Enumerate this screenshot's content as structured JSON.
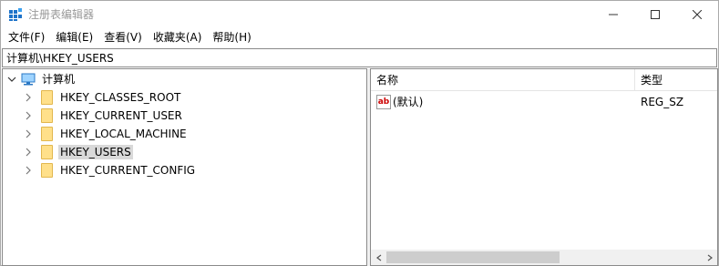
{
  "window": {
    "title": "注册表编辑器",
    "icon": "regedit-icon"
  },
  "menu": {
    "items": [
      "文件(F)",
      "编辑(E)",
      "查看(V)",
      "收藏夹(A)",
      "帮助(H)"
    ]
  },
  "address": {
    "path": "计算机\\HKEY_USERS"
  },
  "tree": {
    "root": "计算机",
    "items": [
      {
        "label": "HKEY_CLASSES_ROOT",
        "selected": false
      },
      {
        "label": "HKEY_CURRENT_USER",
        "selected": false
      },
      {
        "label": "HKEY_LOCAL_MACHINE",
        "selected": false
      },
      {
        "label": "HKEY_USERS",
        "selected": true
      },
      {
        "label": "HKEY_CURRENT_CONFIG",
        "selected": false
      }
    ]
  },
  "list": {
    "columns": {
      "name": "名称",
      "type": "类型"
    },
    "rows": [
      {
        "name": "(默认)",
        "type": "REG_SZ",
        "icon_text": "ab"
      }
    ]
  },
  "colors": {
    "selection": "#d9d9d9",
    "folder": "#ffe08a",
    "border": "#8a8a8a"
  }
}
